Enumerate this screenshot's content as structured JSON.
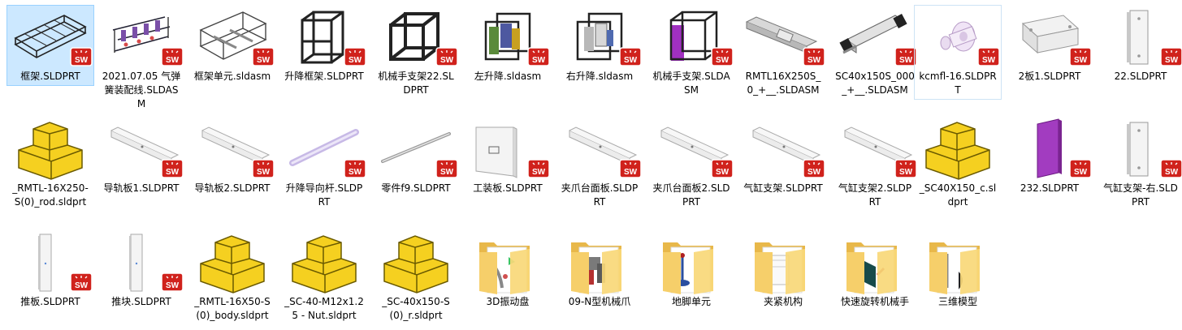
{
  "files": [
    {
      "name": "框架.SLDPRT",
      "icon": "frame-tray-icon",
      "badge": "solidworks-badge-icon",
      "selected": true
    },
    {
      "name": "2021.07.05 气弹簧装配线.SLDASM",
      "icon": "assembly-line-icon",
      "badge": "solidworks-badge-icon"
    },
    {
      "name": "框架单元.sldasm",
      "icon": "frame-unit-icon",
      "badge": "solidworks-badge-icon"
    },
    {
      "name": "升降框架.SLDPRT",
      "icon": "lift-frame-icon",
      "badge": "solidworks-badge-icon"
    },
    {
      "name": "机械手支架22.SLDPRT",
      "icon": "cube-frame-icon",
      "badge": "solidworks-badge-icon"
    },
    {
      "name": "左升降.sldasm",
      "icon": "lift-assembly-left-icon",
      "badge": "solidworks-badge-icon"
    },
    {
      "name": "右升降.sldasm",
      "icon": "lift-assembly-right-icon",
      "badge": "solidworks-badge-icon"
    },
    {
      "name": "机械手支架.SLDASM",
      "icon": "robot-frame-purple-icon",
      "badge": "solidworks-badge-icon"
    },
    {
      "name": "RMTL16X250S_0_+__.SLDASM",
      "icon": "linear-module-icon",
      "badge": "solidworks-badge-icon"
    },
    {
      "name": "SC40x150S_000_+__.SLDASM",
      "icon": "air-cylinder-icon",
      "badge": "solidworks-badge-icon"
    },
    {
      "name": "kcmfl-16.SLDPRT",
      "icon": "flange-part-icon",
      "badge": "solidworks-badge-icon",
      "focused": true
    },
    {
      "name": "2板1.SLDPRT",
      "icon": "plate-icon",
      "badge": "solidworks-badge-icon"
    },
    {
      "name": "22.SLDPRT",
      "icon": "vertical-plate-icon",
      "badge": "solidworks-badge-icon"
    },
    {
      "name": "_RMTL-16X250-S(0)_rod.sldprt",
      "icon": "yellow-part-icon"
    },
    {
      "name": "导轨板1.SLDPRT",
      "icon": "rail-plate-icon",
      "badge": "solidworks-badge-icon"
    },
    {
      "name": "导轨板2.SLDPRT",
      "icon": "rail-plate-icon",
      "badge": "solidworks-badge-icon"
    },
    {
      "name": "升降导向杆.SLDPRT",
      "icon": "guide-rod-icon",
      "badge": "solidworks-badge-icon"
    },
    {
      "name": "零件f9.SLDPRT",
      "icon": "thin-rod-icon",
      "badge": "solidworks-badge-icon"
    },
    {
      "name": "工装板.SLDPRT",
      "icon": "fixture-plate-icon",
      "badge": "solidworks-badge-icon"
    },
    {
      "name": "夹爪台面板.SLDPRT",
      "icon": "rail-plate-icon",
      "badge": "solidworks-badge-icon"
    },
    {
      "name": "夹爪台面板2.SLDPRT",
      "icon": "rail-plate-icon",
      "badge": "solidworks-badge-icon"
    },
    {
      "name": "气缸支架.SLDPRT",
      "icon": "rail-plate-icon",
      "badge": "solidworks-badge-icon"
    },
    {
      "name": "气缸支架2.SLDPRT",
      "icon": "rail-plate-icon",
      "badge": "solidworks-badge-icon"
    },
    {
      "name": "_SC40X150_c.sldprt",
      "icon": "yellow-part-icon"
    },
    {
      "name": "232.SLDPRT",
      "icon": "purple-plate-icon",
      "badge": "solidworks-badge-icon"
    },
    {
      "name": "气缸支架-右.SLDPRT",
      "icon": "vertical-plate-icon",
      "badge": "solidworks-badge-icon"
    },
    {
      "name": "推板.SLDPRT",
      "icon": "narrow-plate-icon",
      "badge": "solidworks-badge-icon"
    },
    {
      "name": "推块.SLDPRT",
      "icon": "narrow-plate-icon",
      "badge": "solidworks-badge-icon"
    },
    {
      "name": "_RMTL-16X50-S(0)_body.sldprt",
      "icon": "yellow-part-icon"
    },
    {
      "name": "_SC-40-M12x1.25 - Nut.sldprt",
      "icon": "yellow-part-icon"
    },
    {
      "name": "_SC-40x150-S(0)_r.sldprt",
      "icon": "yellow-part-icon"
    },
    {
      "name": "3D振动盘",
      "icon": "folder-icon",
      "preview": "vibration"
    },
    {
      "name": "09-N型机械爪",
      "icon": "folder-icon",
      "preview": "gripper"
    },
    {
      "name": "地脚单元",
      "icon": "folder-icon",
      "preview": "foot"
    },
    {
      "name": "夹紧机构",
      "icon": "folder-icon",
      "preview": "clamp"
    },
    {
      "name": "快速旋转机械手",
      "icon": "folder-icon",
      "preview": "rotary"
    },
    {
      "name": "三维模型",
      "icon": "folder-icon",
      "preview": "model"
    }
  ]
}
